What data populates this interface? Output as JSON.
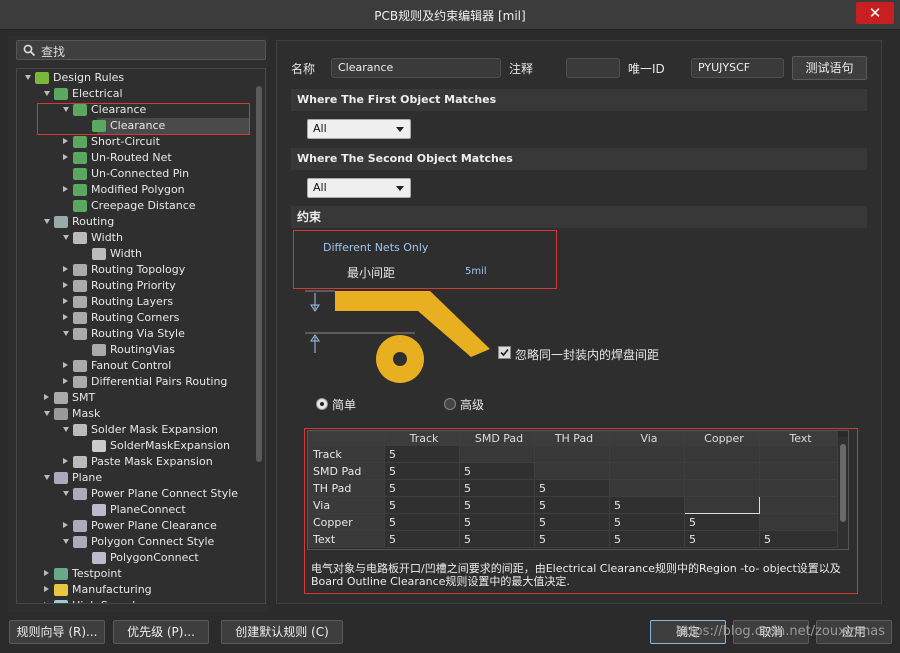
{
  "window": {
    "title": "PCB规则及约束编辑器 [mil]",
    "close_glyph": "✕"
  },
  "search": {
    "placeholder": "查找",
    "icon": "search-icon"
  },
  "tree": [
    {
      "label": "Design Rules",
      "icon": "rules-folder-icon",
      "level": 0,
      "state": "expanded"
    },
    {
      "label": "Electrical",
      "icon": "electrical-icon",
      "level": 1,
      "state": "expanded"
    },
    {
      "label": "Clearance",
      "icon": "rule-icon",
      "level": 2,
      "state": "expanded"
    },
    {
      "label": "Clearance",
      "icon": "rule-item-icon",
      "level": 3,
      "state": "none",
      "selected": true
    },
    {
      "label": "Short-Circuit",
      "icon": "rule-icon",
      "level": 2,
      "state": "collapsed"
    },
    {
      "label": "Un-Routed Net",
      "icon": "rule-icon",
      "level": 2,
      "state": "collapsed"
    },
    {
      "label": "Un-Connected Pin",
      "icon": "rule-icon",
      "level": 2,
      "state": "none"
    },
    {
      "label": "Modified Polygon",
      "icon": "rule-icon",
      "level": 2,
      "state": "collapsed"
    },
    {
      "label": "Creepage Distance",
      "icon": "rule-icon",
      "level": 2,
      "state": "none"
    },
    {
      "label": "Routing",
      "icon": "routing-icon",
      "level": 1,
      "state": "expanded"
    },
    {
      "label": "Width",
      "icon": "width-icon",
      "level": 2,
      "state": "expanded"
    },
    {
      "label": "Width",
      "icon": "width-item-icon",
      "level": 3,
      "state": "none"
    },
    {
      "label": "Routing Topology",
      "icon": "topology-icon",
      "level": 2,
      "state": "collapsed"
    },
    {
      "label": "Routing Priority",
      "icon": "priority-icon",
      "level": 2,
      "state": "collapsed"
    },
    {
      "label": "Routing Layers",
      "icon": "layers-icon",
      "level": 2,
      "state": "collapsed"
    },
    {
      "label": "Routing Corners",
      "icon": "corners-icon",
      "level": 2,
      "state": "collapsed"
    },
    {
      "label": "Routing Via Style",
      "icon": "via-icon",
      "level": 2,
      "state": "expanded"
    },
    {
      "label": "RoutingVias",
      "icon": "via-item-icon",
      "level": 3,
      "state": "none"
    },
    {
      "label": "Fanout Control",
      "icon": "fanout-icon",
      "level": 2,
      "state": "collapsed"
    },
    {
      "label": "Differential Pairs Routing",
      "icon": "diffpair-icon",
      "level": 2,
      "state": "collapsed"
    },
    {
      "label": "SMT",
      "icon": "smt-icon",
      "level": 1,
      "state": "collapsed"
    },
    {
      "label": "Mask",
      "icon": "mask-icon",
      "level": 1,
      "state": "expanded"
    },
    {
      "label": "Solder Mask Expansion",
      "icon": "mask-rule-icon",
      "level": 2,
      "state": "expanded"
    },
    {
      "label": "SolderMaskExpansion",
      "icon": "mask-item-icon",
      "level": 3,
      "state": "none"
    },
    {
      "label": "Paste Mask Expansion",
      "icon": "mask-rule-icon",
      "level": 2,
      "state": "collapsed"
    },
    {
      "label": "Plane",
      "icon": "plane-icon",
      "level": 1,
      "state": "expanded"
    },
    {
      "label": "Power Plane Connect Style",
      "icon": "plane-rule-icon",
      "level": 2,
      "state": "expanded"
    },
    {
      "label": "PlaneConnect",
      "icon": "plane-item-icon",
      "level": 3,
      "state": "none"
    },
    {
      "label": "Power Plane Clearance",
      "icon": "plane-rule-icon",
      "level": 2,
      "state": "collapsed"
    },
    {
      "label": "Polygon Connect Style",
      "icon": "plane-rule-icon",
      "level": 2,
      "state": "expanded"
    },
    {
      "label": "PolygonConnect",
      "icon": "plane-item-icon",
      "level": 3,
      "state": "none"
    },
    {
      "label": "Testpoint",
      "icon": "testpoint-icon",
      "level": 1,
      "state": "collapsed"
    },
    {
      "label": "Manufacturing",
      "icon": "manufacturing-icon",
      "level": 1,
      "state": "collapsed"
    },
    {
      "label": "High Speed",
      "icon": "highspeed-icon",
      "level": 1,
      "state": "collapsed"
    }
  ],
  "form": {
    "name_label": "名称",
    "name_value": "Clearance",
    "comment_label": "注释",
    "comment_value": "",
    "uid_label": "唯一ID",
    "uid_value": "PYUJYSCF",
    "test_button": "测试语句"
  },
  "first_match": {
    "heading": "Where The First Object Matches",
    "value": "All"
  },
  "second_match": {
    "heading": "Where The Second Object Matches",
    "value": "All"
  },
  "constraints": {
    "heading": "约束",
    "net_scope": "Different Nets Only",
    "min_clearance_label": "最小间距",
    "min_clearance_value": "5mil",
    "ignore_pads_label": "忽略同一封装内的焊盘间距",
    "ignore_pads_checked": true,
    "mode_simple": "简单",
    "mode_advanced": "高级",
    "mode_selected": "simple",
    "track_color": "#e8b020"
  },
  "grid": {
    "columns": [
      "",
      "Track",
      "SMD Pad",
      "TH Pad",
      "Via",
      "Copper",
      "Text"
    ],
    "rows": [
      {
        "label": "Track",
        "cells": [
          "5",
          "",
          "",
          "",
          "",
          ""
        ]
      },
      {
        "label": "SMD Pad",
        "cells": [
          "5",
          "5",
          "",
          "",
          "",
          ""
        ]
      },
      {
        "label": "TH Pad",
        "cells": [
          "5",
          "5",
          "5",
          "",
          "",
          ""
        ]
      },
      {
        "label": "Via",
        "cells": [
          "5",
          "5",
          "5",
          "5",
          "",
          ""
        ]
      },
      {
        "label": "Copper",
        "cells": [
          "5",
          "5",
          "5",
          "5",
          "5",
          ""
        ]
      },
      {
        "label": "Text",
        "cells": [
          "5",
          "5",
          "5",
          "5",
          "5",
          "5"
        ]
      }
    ]
  },
  "description": "电气对象与电路板开口/凹槽之间要求的间距，由Electrical Clearance规则中的Region -to- object设置以及Board Outline Clearance规则设置中的最大值决定.",
  "bottom": {
    "wizard": "规则向导 (R)...",
    "priority": "优先级 (P)...",
    "create_default": "创建默认规则 (C)",
    "ok": "确定",
    "cancel": "取消",
    "apply": "应用",
    "watermark": "https://blog.csdn.net/zouxinmas"
  }
}
